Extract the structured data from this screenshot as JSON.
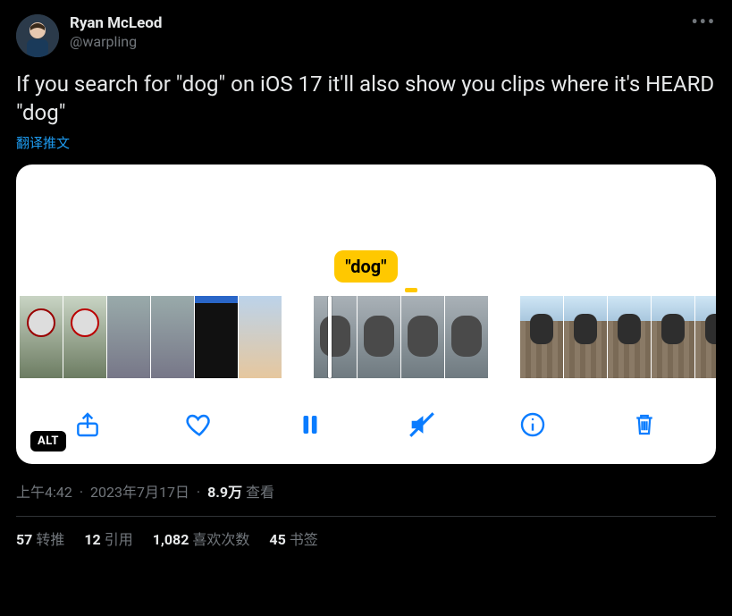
{
  "author": {
    "display_name": "Ryan McLeod",
    "handle": "@warpling"
  },
  "more_label": "•••",
  "content_text": "If you search for \"dog\" on iOS 17 it'll also show you clips where it's HEARD \"dog\"",
  "translate_label": "翻译推文",
  "media": {
    "caption_bubble": "\"dog\"",
    "alt_badge": "ALT",
    "toolbar": {
      "share": "share-icon",
      "like": "heart-icon",
      "pause": "pause-icon",
      "mute": "speaker-mute-icon",
      "info": "info-icon",
      "trash": "trash-icon"
    }
  },
  "meta": {
    "time": "上午4:42",
    "date": "2023年7月17日",
    "views_count": "8.9万",
    "views_label": "查看"
  },
  "stats": {
    "retweets_count": "57",
    "retweets_label": "转推",
    "quotes_count": "12",
    "quotes_label": "引用",
    "likes_count": "1,082",
    "likes_label": "喜欢次数",
    "bookmarks_count": "45",
    "bookmarks_label": "书签"
  }
}
